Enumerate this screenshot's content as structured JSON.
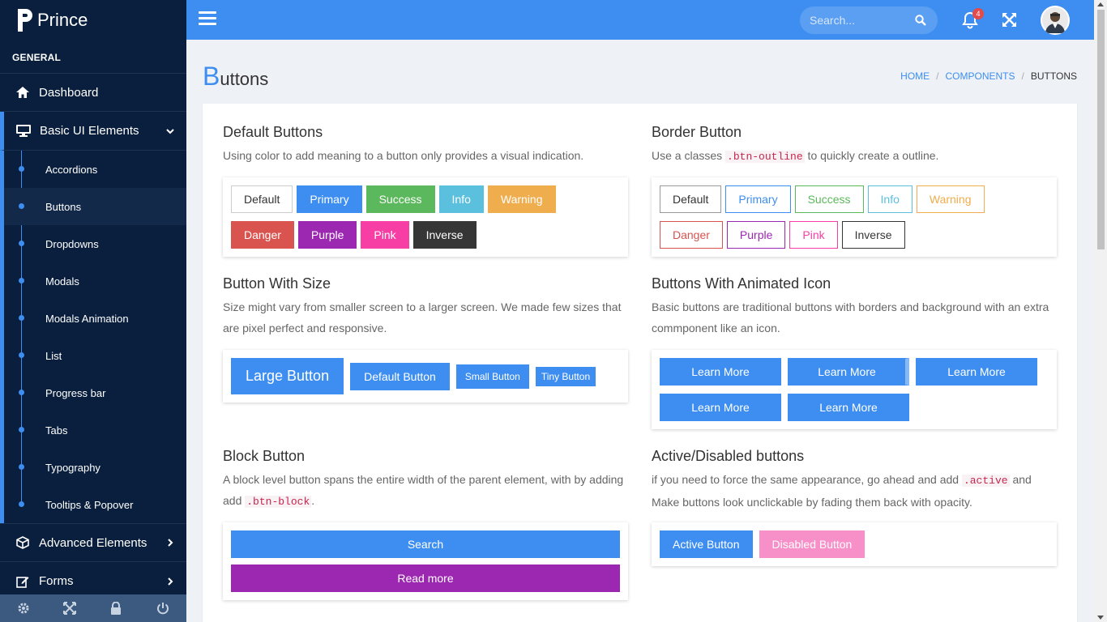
{
  "app": {
    "brand": "Prince"
  },
  "sidebar": {
    "section": "GENERAL",
    "dashboard": "Dashboard",
    "basic_ui": "Basic UI Elements",
    "sub_items": [
      "Accordions",
      "Buttons",
      "Dropdowns",
      "Modals",
      "Modals Animation",
      "List",
      "Progress bar",
      "Tabs",
      "Typography",
      "Tooltips & Popover"
    ],
    "advanced": "Advanced Elements",
    "forms": "Forms"
  },
  "header": {
    "search_placeholder": "Search...",
    "notification_count": "4"
  },
  "page": {
    "title_first": "B",
    "title_rest": "uttons",
    "breadcrumb": {
      "home": "HOME",
      "components": "COMPONENTS",
      "current": "BUTTONS"
    }
  },
  "default_buttons": {
    "title": "Default Buttons",
    "desc": "Using color to add meaning to a button only provides a visual indication.",
    "labels": [
      "Default",
      "Primary",
      "Success",
      "Info",
      "Warning",
      "Danger",
      "Purple",
      "Pink",
      "Inverse"
    ]
  },
  "border_button": {
    "title": "Border Button",
    "desc_before": "Use a classes ",
    "code": ".btn-outline",
    "desc_after": " to quickly create a outline.",
    "labels": [
      "Default",
      "Primary",
      "Success",
      "Info",
      "Warning",
      "Danger",
      "Purple",
      "Pink",
      "Inverse"
    ]
  },
  "size_buttons": {
    "title": "Button With Size",
    "desc": "Size might vary from smaller screen to a larger screen. We made few sizes that are pixel perfect and responsive.",
    "large": "Large Button",
    "default": "Default Button",
    "small": "Small Button",
    "tiny": "Tiny Button"
  },
  "animated_icon": {
    "title": "Buttons With Animated Icon",
    "desc": "Basic buttons are traditional buttons with borders and background with an extra commponent like an icon.",
    "labels": [
      "Learn More",
      "Learn More",
      "Learn More",
      "Learn More",
      "Learn More"
    ]
  },
  "block_button": {
    "title": "Block Button",
    "desc_before": "A block level button spans the entire width of the parent element, with by adding add ",
    "code": ".btn-block",
    "desc_after": ".",
    "search": "Search",
    "read_more": "Read more"
  },
  "active_disabled": {
    "title": "Active/Disabled buttons",
    "desc_before": "if you need to force the same appearance, go ahead and add ",
    "code": ".active",
    "desc_after": " and Make buttons look unclickable by fading them back with opacity.",
    "active": "Active Button",
    "disabled": "Disabled Button"
  },
  "colors": {
    "accent": "#3d8ef0",
    "sidebar": "#0a1f3d"
  }
}
